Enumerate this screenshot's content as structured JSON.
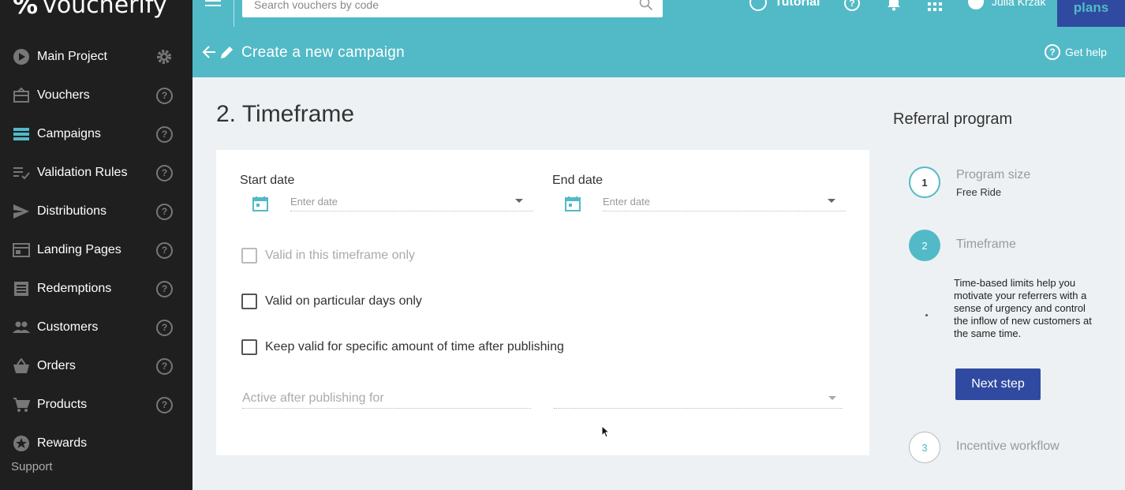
{
  "brand": {
    "logo_mark": "%",
    "logo_text": "voucherify"
  },
  "sidebar": {
    "items": [
      {
        "label": "Main Project",
        "icon": "play-icon"
      },
      {
        "label": "Vouchers",
        "icon": "voucher-icon"
      },
      {
        "label": "Campaigns",
        "icon": "campaigns-icon"
      },
      {
        "label": "Validation Rules",
        "icon": "rules-icon"
      },
      {
        "label": "Distributions",
        "icon": "send-icon"
      },
      {
        "label": "Landing Pages",
        "icon": "page-icon"
      },
      {
        "label": "Redemptions",
        "icon": "list-icon"
      },
      {
        "label": "Customers",
        "icon": "people-icon"
      },
      {
        "label": "Orders",
        "icon": "basket-icon"
      },
      {
        "label": "Products",
        "icon": "cart-icon"
      },
      {
        "label": "Rewards",
        "icon": "star-icon"
      }
    ],
    "help_glyph": "?",
    "support": "Support"
  },
  "topbar": {
    "search_placeholder": "Search vouchers by code",
    "tutorial": "Tutorial",
    "help_glyph": "?",
    "user_name": "Julia Krzak",
    "plans": "plans"
  },
  "header": {
    "title": "Create a new campaign",
    "get_help": "Get help"
  },
  "main": {
    "section_title": "2. Timeframe",
    "start_date_label": "Start date",
    "end_date_label": "End date",
    "date_placeholder": "Enter date",
    "checkboxes": [
      {
        "label": "Valid in this timeframe only",
        "disabled": true
      },
      {
        "label": "Valid on particular days only",
        "disabled": false
      },
      {
        "label": "Keep valid for specific amount of time after publishing",
        "disabled": false
      }
    ],
    "active_after_placeholder": "Active after publishing for"
  },
  "panel": {
    "title": "Referral program",
    "steps": [
      {
        "number": "1",
        "title": "Program size",
        "subtitle": "Free Ride"
      },
      {
        "number": "2",
        "title": "Timeframe",
        "description": "Time-based limits help you motivate your referrers with a sense of urgency and control the inflow of new customers at the same time."
      },
      {
        "number": "3",
        "title": "Incentive workflow"
      }
    ],
    "next_button": "Next step"
  },
  "colors": {
    "accent": "#52bac7",
    "primary": "#2f4aa0",
    "sidebar": "#1f1f1f"
  }
}
